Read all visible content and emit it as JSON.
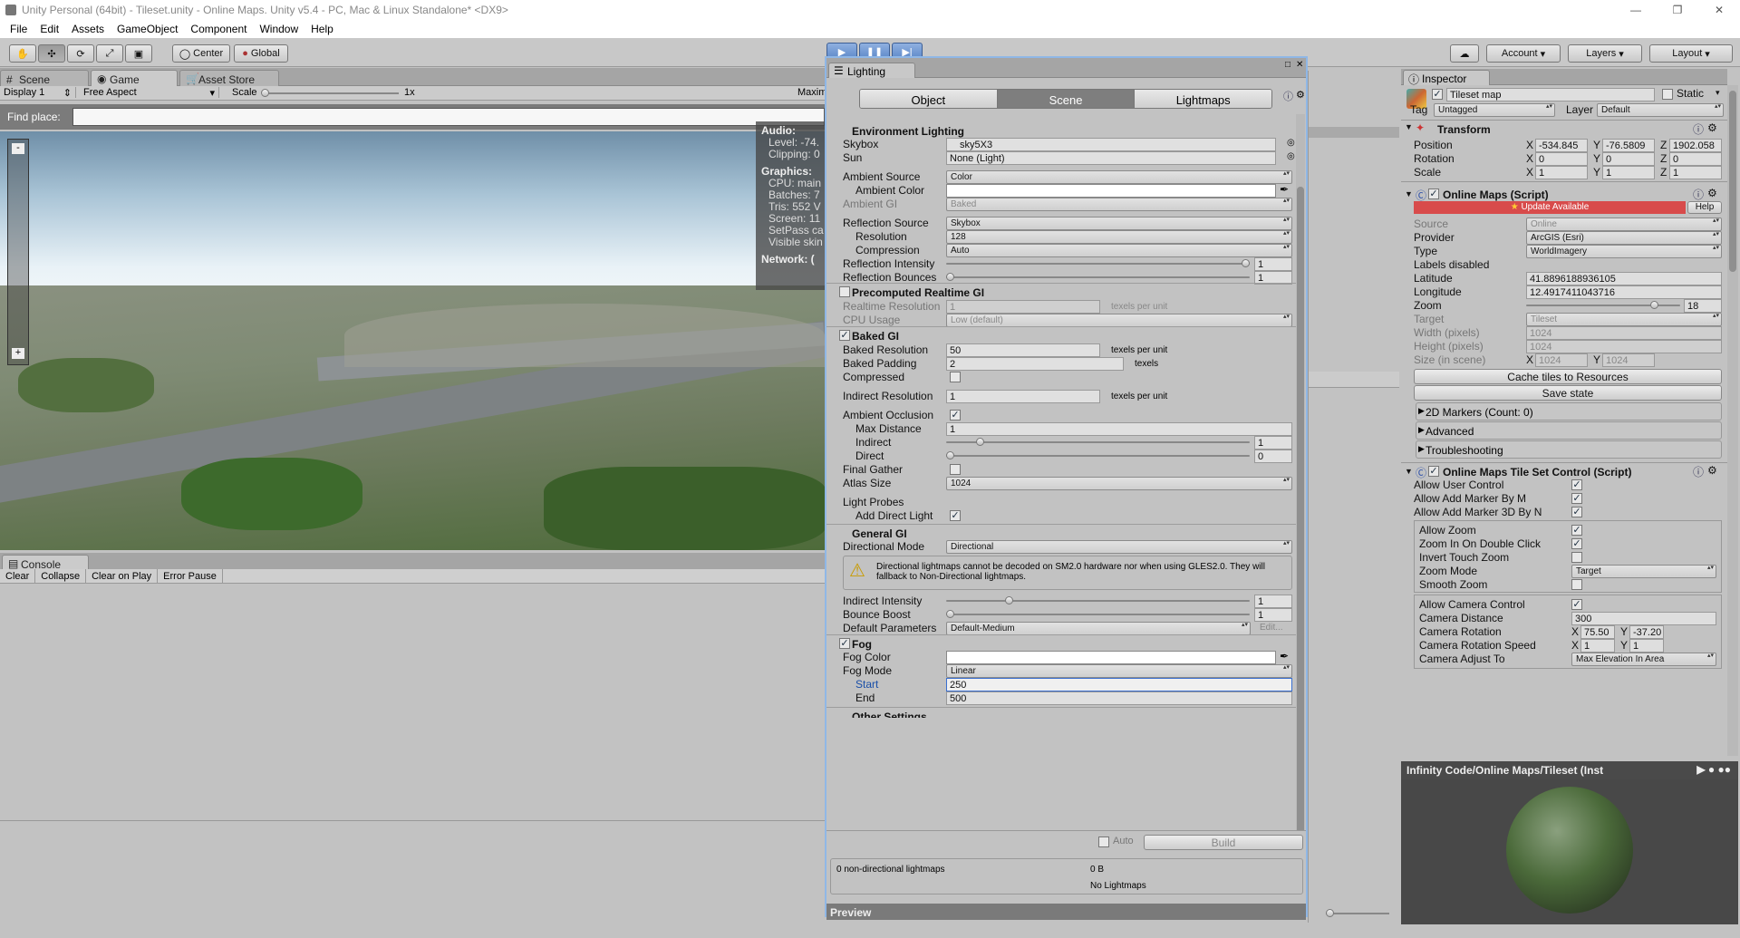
{
  "window": {
    "title": "Unity Personal (64bit) - Tileset.unity - Online Maps. Unity v5.4 - PC, Mac & Linux Standalone* <DX9>"
  },
  "menu": [
    "File",
    "Edit",
    "Assets",
    "GameObject",
    "Component",
    "Window",
    "Help"
  ],
  "toolbar": {
    "pivot": "Center",
    "space": "Global",
    "account": "Account",
    "layers": "Layers",
    "layout": "Layout"
  },
  "tabs": {
    "scene": "Scene",
    "game": "Game",
    "asset_store": "Asset Store"
  },
  "game": {
    "display": "Display 1",
    "aspect": "Free Aspect",
    "scale_label": "Scale",
    "scale_value": "1x",
    "maximize": "Maxim",
    "find_place": "Find place:",
    "stats": {
      "audio": "Audio:",
      "level": "Level: -74.",
      "clipping": "Clipping: 0",
      "graphics": "Graphics:",
      "cpu": "CPU: main",
      "batches": "Batches: 7",
      "tris": "Tris: 552 V",
      "screen": "Screen: 11",
      "setpass": "SetPass ca",
      "visible": "Visible skin",
      "network": "Network: ("
    }
  },
  "console": {
    "tab": "Console",
    "buttons": [
      "Clear",
      "Collapse",
      "Clear on Play",
      "Error Pause"
    ]
  },
  "lighting": {
    "title": "Lighting",
    "tabs": [
      "Object",
      "Scene",
      "Lightmaps"
    ],
    "env_header": "Environment Lighting",
    "skybox_label": "Skybox",
    "skybox_value": "sky5X3",
    "sun_label": "Sun",
    "sun_value": "None (Light)",
    "ambient_source_label": "Ambient Source",
    "ambient_source_value": "Color",
    "ambient_color_label": "Ambient Color",
    "ambient_gi_label": "Ambient GI",
    "ambient_gi_value": "Baked",
    "reflection_source_label": "Reflection Source",
    "reflection_source_value": "Skybox",
    "resolution_label": "Resolution",
    "resolution_value": "128",
    "compression_label": "Compression",
    "compression_value": "Auto",
    "reflection_intensity_label": "Reflection Intensity",
    "reflection_intensity_value": "1",
    "reflection_intensity_level": 1.0,
    "reflection_bounces_label": "Reflection Bounces",
    "reflection_bounces_value": "1",
    "reflection_bounces_level": 0.0,
    "precomputed_header": "Precomputed Realtime GI",
    "realtime_resolution_label": "Realtime Resolution",
    "realtime_resolution_value": "1",
    "texels_per_unit": "texels per unit",
    "cpu_usage_label": "CPU Usage",
    "cpu_usage_value": "Low (default)",
    "baked_header": "Baked GI",
    "baked_resolution_label": "Baked Resolution",
    "baked_resolution_value": "50",
    "baked_padding_label": "Baked Padding",
    "baked_padding_value": "2",
    "texels": "texels",
    "compressed_label": "Compressed",
    "indirect_resolution_label": "Indirect Resolution",
    "indirect_resolution_value": "1",
    "ambient_occlusion_label": "Ambient Occlusion",
    "max_distance_label": "Max Distance",
    "max_distance_value": "1",
    "indirect_label": "Indirect",
    "indirect_value": "1",
    "indirect_level": 0.1,
    "direct_label": "Direct",
    "direct_value": "0",
    "direct_level": 0.0,
    "final_gather_label": "Final Gather",
    "atlas_size_label": "Atlas Size",
    "atlas_size_value": "1024",
    "light_probes_label": "Light Probes",
    "add_direct_light_label": "Add Direct Light",
    "general_header": "General GI",
    "directional_mode_label": "Directional Mode",
    "directional_mode_value": "Directional",
    "warning": "Directional lightmaps cannot be decoded on SM2.0 hardware nor when using GLES2.0. They will fallback to Non-Directional lightmaps.",
    "indirect_intensity_label": "Indirect Intensity",
    "indirect_intensity_value": "1",
    "indirect_intensity_level": 0.2,
    "bounce_boost_label": "Bounce Boost",
    "bounce_boost_value": "1",
    "bounce_boost_level": 0.0,
    "default_params_label": "Default Parameters",
    "default_params_value": "Default-Medium",
    "edit": "Edit...",
    "fog_header": "Fog",
    "fog_color_label": "Fog Color",
    "fog_mode_label": "Fog Mode",
    "fog_mode_value": "Linear",
    "start_label": "Start",
    "start_value": "250",
    "end_label": "End",
    "end_value": "500",
    "other_settings": "Other Settings",
    "auto_label": "Auto",
    "build_label": "Build",
    "footer_lightmaps": "0 non-directional lightmaps",
    "footer_size": "0 B",
    "footer_none": "No Lightmaps",
    "preview": "Preview"
  },
  "inspector": {
    "title": "Inspector",
    "object_name": "Tileset map",
    "static_label": "Static",
    "tag_label": "Tag",
    "tag_value": "Untagged",
    "layer_label": "Layer",
    "layer_value": "Default",
    "transform_header": "Transform",
    "position_label": "Position",
    "pos_x": "-534.845",
    "pos_y": "-76.5809",
    "pos_z": "1902.058",
    "rotation_label": "Rotation",
    "rot_x": "0",
    "rot_y": "0",
    "rot_z": "0",
    "scale_label": "Scale",
    "scl_x": "1",
    "scl_y": "1",
    "scl_z": "1",
    "x": "X",
    "y": "Y",
    "z": "Z",
    "om_header": "Online Maps (Script)",
    "update_available": "Update Available",
    "help": "Help",
    "source_label": "Source",
    "source_value": "Online",
    "provider_label": "Provider",
    "provider_value": "ArcGIS (Esri)",
    "type_label": "Type",
    "type_value": "WorldImagery",
    "labels_disabled": "Labels disabled",
    "latitude_label": "Latitude",
    "latitude_value": "41.8896188936105",
    "longitude_label": "Longitude",
    "longitude_value": "12.4917411043716",
    "zoom_label": "Zoom",
    "zoom_value": "18",
    "zoom_level": 0.85,
    "target_label": "Target",
    "target_value": "Tileset",
    "width_label": "Width (pixels)",
    "width_value": "1024",
    "height_label": "Height (pixels)",
    "height_value": "1024",
    "size_label": "Size (in scene)",
    "size_x": "1024",
    "size_y": "1024",
    "cache_btn": "Cache tiles to Resources",
    "save_btn": "Save state",
    "markers_section": "2D Markers (Count: 0)",
    "advanced_section": "Advanced",
    "troubleshooting_section": "Troubleshooting",
    "tsc_header": "Online Maps Tile Set Control (Script)",
    "allow_user_control": "Allow User Control",
    "allow_add_marker": "Allow Add Marker By M",
    "allow_add_marker3d": "Allow Add Marker 3D By N",
    "allow_zoom": "Allow Zoom",
    "zoom_double_click": "Zoom In On Double Click",
    "invert_touch_zoom": "Invert Touch Zoom",
    "zoom_mode_label": "Zoom Mode",
    "zoom_mode_value": "Target",
    "smooth_zoom": "Smooth Zoom",
    "allow_camera_control": "Allow Camera Control",
    "camera_distance_label": "Camera Distance",
    "camera_distance_value": "300",
    "camera_rotation_label": "Camera Rotation",
    "cam_rot_x": "75.50",
    "cam_rot_y": "-37.20",
    "camera_rotation_speed_label": "Camera Rotation Speed",
    "cam_spd_x": "1",
    "cam_spd_y": "1",
    "camera_adjust_label": "Camera Adjust To",
    "camera_adjust_value": "Max Elevation In Area",
    "preview_title": "Infinity Code/Online Maps/Tileset (Inst"
  }
}
